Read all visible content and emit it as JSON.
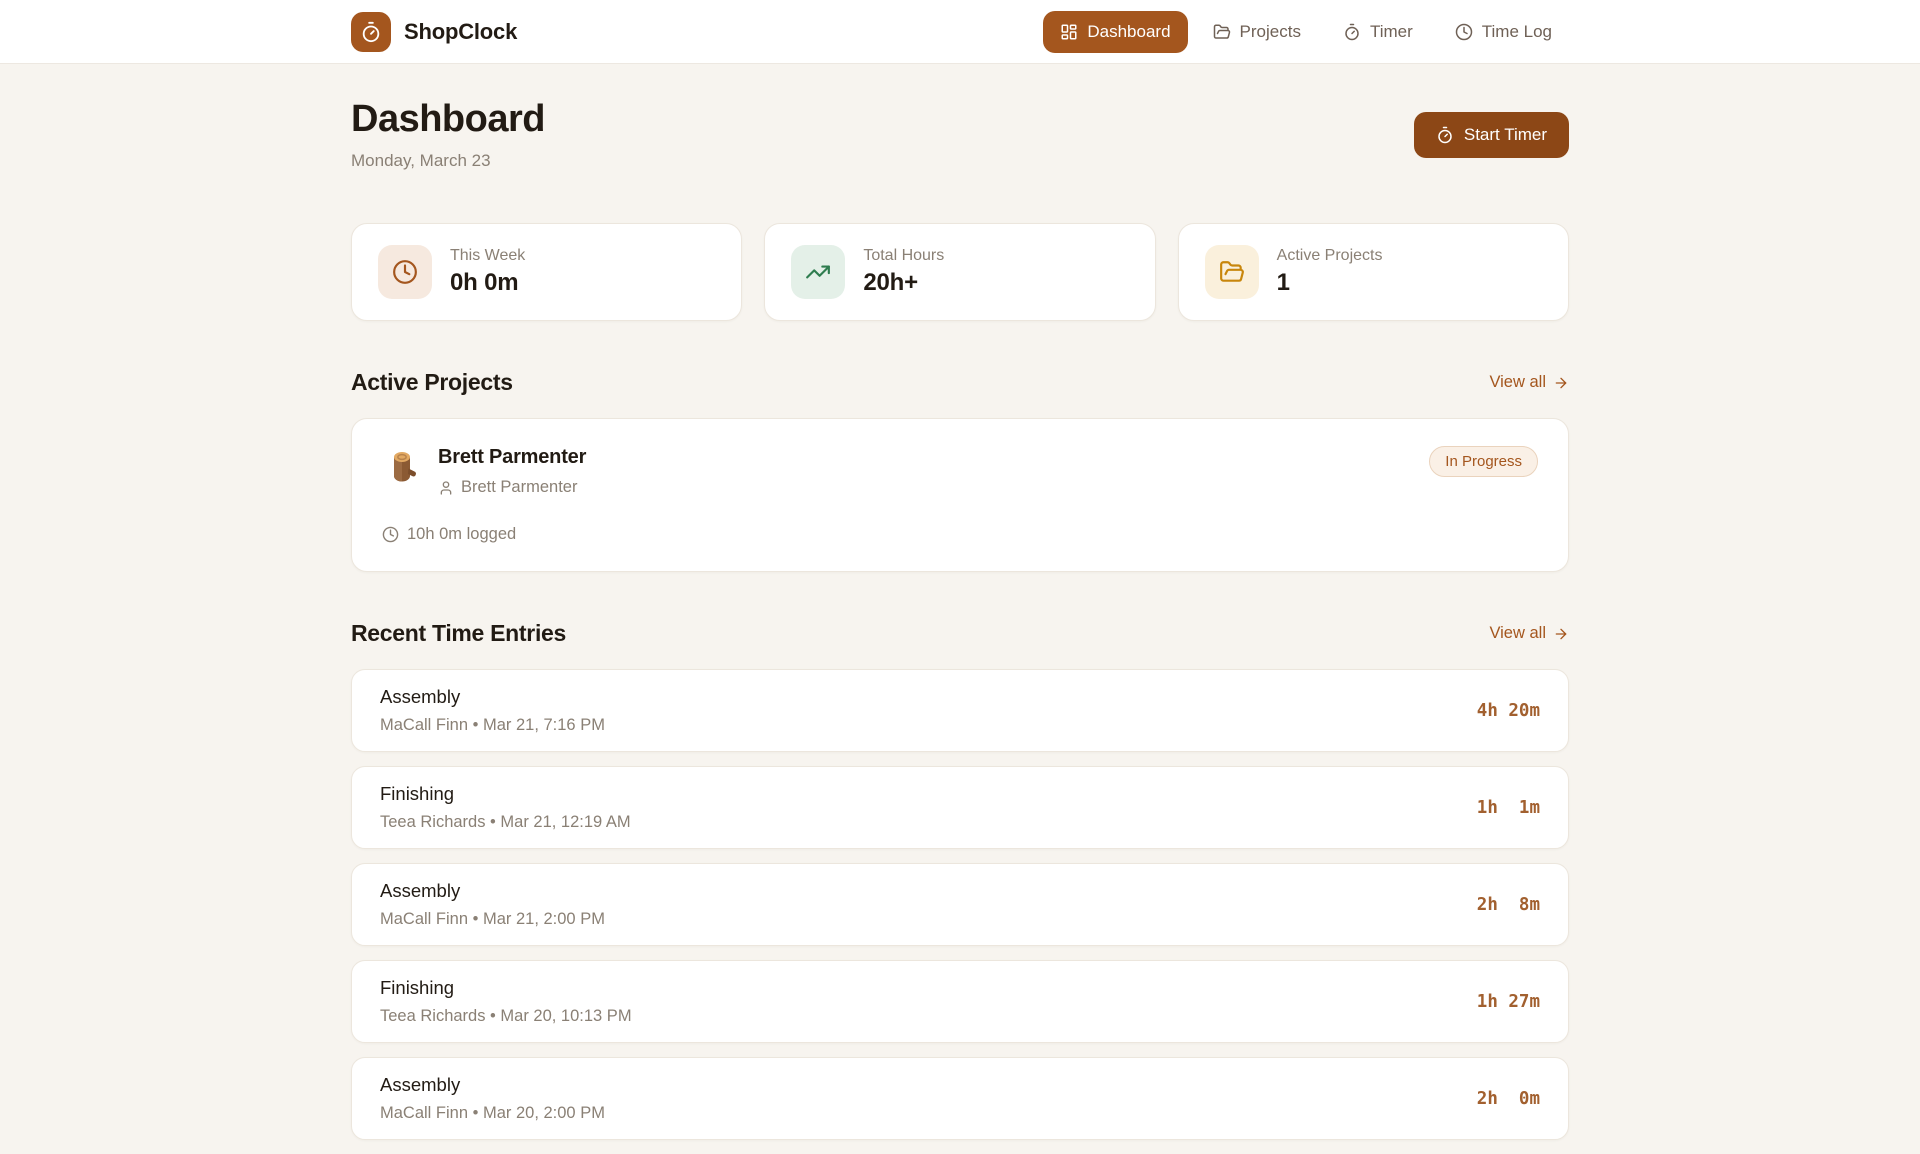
{
  "brand": {
    "name": "ShopClock"
  },
  "nav": {
    "dashboard": "Dashboard",
    "projects": "Projects",
    "timer": "Timer",
    "time_log": "Time Log"
  },
  "header": {
    "title": "Dashboard",
    "date": "Monday, March 23",
    "start_timer": "Start Timer"
  },
  "stats": {
    "this_week": {
      "label": "This Week",
      "value": "0h 0m"
    },
    "total_hours": {
      "label": "Total Hours",
      "value": "20h+"
    },
    "active_projects": {
      "label": "Active Projects",
      "value": "1"
    }
  },
  "active_projects": {
    "heading": "Active Projects",
    "view_all": "View all",
    "project": {
      "name": "Brett Parmenter",
      "client": "Brett Parmenter",
      "status": "In Progress",
      "logged": "10h 0m logged",
      "icon": "wood-log-emoji"
    }
  },
  "recent_entries": {
    "heading": "Recent Time Entries",
    "view_all": "View all",
    "entries": [
      {
        "task": "Assembly",
        "meta": "MaCall Finn • Mar 21, 7:16 PM",
        "duration": "4h 20m"
      },
      {
        "task": "Finishing",
        "meta": "Teea Richards • Mar 21, 12:19 AM",
        "duration": "1h  1m"
      },
      {
        "task": "Assembly",
        "meta": "MaCall Finn • Mar 21, 2:00 PM",
        "duration": "2h  8m"
      },
      {
        "task": "Finishing",
        "meta": "Teea Richards • Mar 20, 10:13 PM",
        "duration": "1h 27m"
      },
      {
        "task": "Assembly",
        "meta": "MaCall Finn • Mar 20, 2:00 PM",
        "duration": "2h  0m"
      }
    ]
  },
  "colors": {
    "accent": "#A4561E",
    "accent_dark": "#8C4716",
    "success": "#2F7D4F",
    "warning": "#C8860B",
    "background": "#F7F4EF",
    "badge_bg": "#FAF0E6",
    "duration_text": "#A2602F"
  }
}
